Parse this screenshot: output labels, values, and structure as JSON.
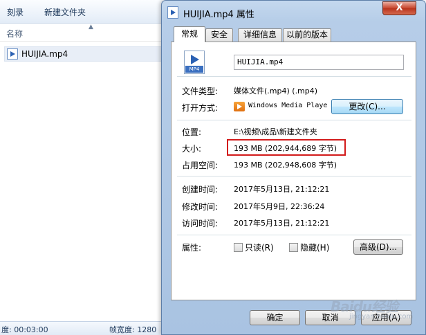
{
  "explorer": {
    "toolbar": {
      "burn": "刻录",
      "new_folder": "新建文件夹"
    },
    "column_name": "名称",
    "file_name": "HUIJIA.mp4",
    "status": {
      "duration": "度: 00:03:00",
      "frame_width": "帧宽度: 1280"
    }
  },
  "dialog": {
    "title": "HUIJIA.mp4 属性",
    "close": "X",
    "tabs": [
      "常规",
      "安全",
      "详细信息",
      "以前的版本"
    ],
    "icon_label": "MP4",
    "filename": "HUIJIA.mp4",
    "file_type_label": "文件类型:",
    "file_type_value": "媒体文件(.mp4) (.mp4)",
    "open_with_label": "打开方式:",
    "open_with_value": "Windows Media Player",
    "change_button": "更改(C)...",
    "location_label": "位置:",
    "location_value": "E:\\视频\\成品\\新建文件夹",
    "size_label": "大小:",
    "size_value": "193 MB (202,944,689 字节)",
    "size_on_disk_label": "占用空间:",
    "size_on_disk_value": "193 MB (202,948,608 字节)",
    "created_label": "创建时间:",
    "created_value": "2017年5月13日, 21:12:21",
    "modified_label": "修改时间:",
    "modified_value": "2017年5月9日, 22:36:24",
    "accessed_label": "访问时间:",
    "accessed_value": "2017年5月13日, 21:12:21",
    "attributes_label": "属性:",
    "readonly_label": "只读(R)",
    "hidden_label": "隐藏(H)",
    "advanced_button": "高级(D)...",
    "ok_button": "确定",
    "cancel_button": "取消",
    "apply_button": "应用(A)"
  },
  "watermark": {
    "text": "Baidu经验",
    "sub": "jingyan.baidu.com"
  },
  "colors": {
    "highlight": "#d21a1a",
    "dialog_frame": "#b6cde8"
  }
}
